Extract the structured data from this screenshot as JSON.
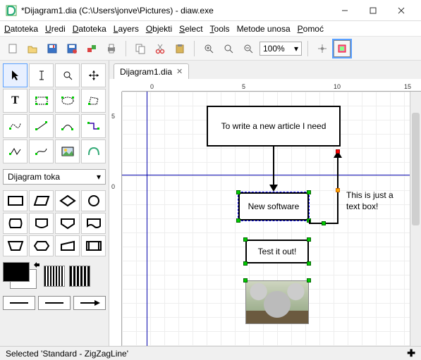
{
  "title": "*Dijagram1.dia (C:\\Users\\jonve\\Pictures) - diaw.exe",
  "menu": [
    "Datoteka",
    "Uredi",
    "Datoteka",
    "Layers",
    "Objekti",
    "Select",
    "Tools",
    "Metode unosa",
    "Pomoć"
  ],
  "menu_underline_idx": [
    0,
    0,
    0,
    0,
    0,
    0,
    0,
    0,
    0
  ],
  "toolbar": {
    "zoom_value": "100%"
  },
  "left": {
    "sheet": "Dijagram toka"
  },
  "doc": {
    "tab_label": "Dijagram1.dia",
    "ruler_h": [
      "0",
      "5",
      "10",
      "15"
    ],
    "ruler_v": [
      "5",
      "0"
    ]
  },
  "nodes": {
    "box1": "To write a new article I need",
    "box2": "New software",
    "box3": "Test it out!",
    "text_side": "This is just a text box!"
  },
  "status": "Selected 'Standard - ZigZagLine'"
}
